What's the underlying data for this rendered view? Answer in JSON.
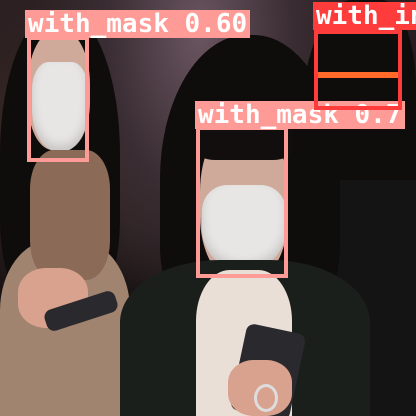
{
  "detections": [
    {
      "label": "with_mask 0.60",
      "color": "#ff9b96"
    },
    {
      "label": "with_mask 0.7",
      "color": "#ff9b96"
    },
    {
      "label": "with_in",
      "color": "#ff3c3c"
    }
  ]
}
